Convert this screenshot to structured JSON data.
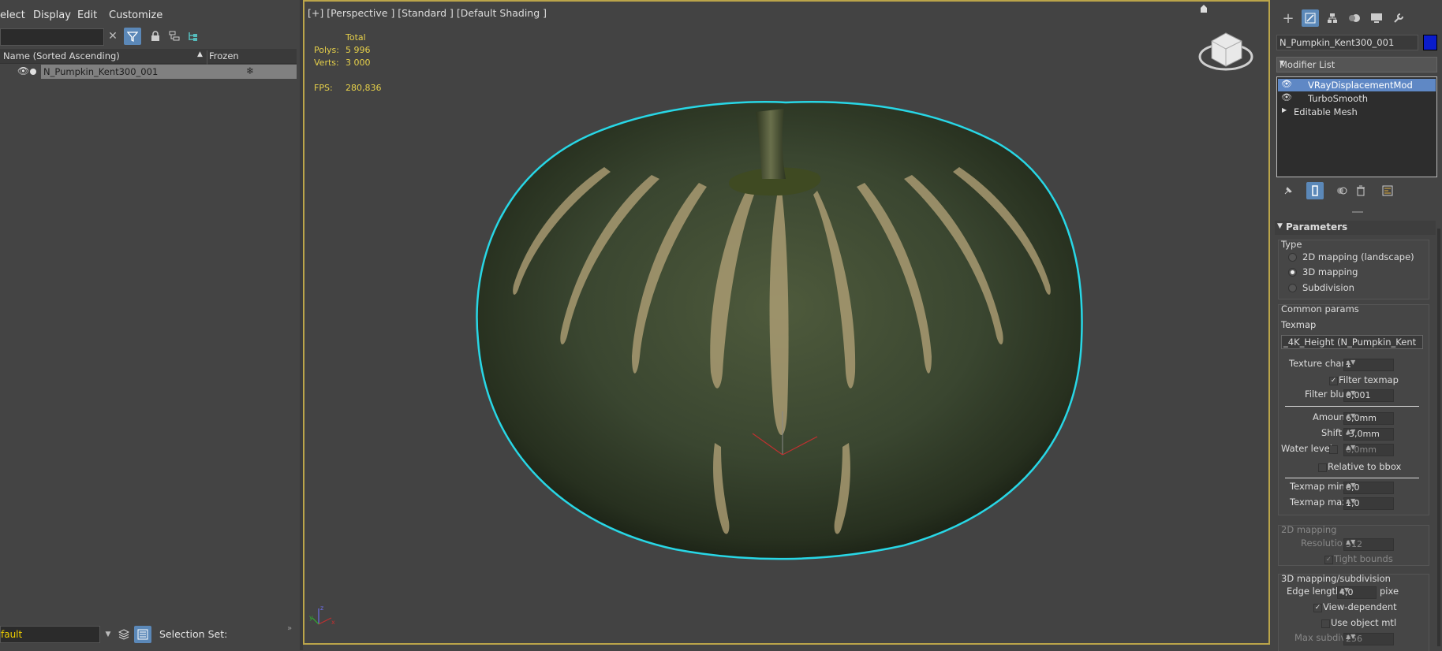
{
  "explorer": {
    "menu": [
      "elect",
      "Display",
      "Edit",
      "Customize"
    ],
    "columns": {
      "name": "Name (Sorted Ascending)",
      "sort_arrow": "▲",
      "frozen": "Frozen"
    },
    "rows": [
      {
        "label": "N_Pumpkin_Kent300_001"
      }
    ],
    "layer_value": "fault",
    "selection_set_label": "Selection Set:"
  },
  "viewport": {
    "label": "[+] [Perspective ] [Standard ] [Default Shading ]",
    "stats": {
      "total_label": "Total",
      "polys_label": "Polys:",
      "polys_value": "5 996",
      "verts_label": "Verts:",
      "verts_value": "3 000",
      "fps_label": "FPS:",
      "fps_value": "280,836"
    },
    "selection_outline_color": "#28d7e6",
    "border_color": "#bba54a"
  },
  "command_panel": {
    "object_name": "N_Pumpkin_Kent300_001",
    "object_color": "#0a1ccc",
    "modifier_list_label": "Modifier List",
    "stack": [
      {
        "label": "VRayDisplacementMod",
        "selected": true
      },
      {
        "label": "TurboSmooth",
        "selected": false
      },
      {
        "label": "Editable Mesh",
        "selected": false
      }
    ],
    "parameters": {
      "rollout_title": "Parameters",
      "type_group": "Type",
      "type_options": [
        {
          "label": "2D mapping (landscape)",
          "selected": false
        },
        {
          "label": "3D mapping",
          "selected": true
        },
        {
          "label": "Subdivision",
          "selected": false
        }
      ],
      "common_group": "Common params",
      "texmap_label": "Texmap",
      "texmap_value": "_4K_Height (N_Pumpkin_Kent",
      "texture_chan_label": "Texture chan",
      "texture_chan_value": "1",
      "filter_texmap_label": "Filter texmap",
      "filter_blur_label": "Filter blur",
      "filter_blur_value": "0,001",
      "amount_label": "Amount",
      "amount_value": "6,0mm",
      "shift_label": "Shift",
      "shift_value": "-3,0mm",
      "water_level_label": "Water level",
      "water_level_value": "0,0mm",
      "relative_bbox_label": "Relative to bbox",
      "texmap_min_label": "Texmap min",
      "texmap_min_value": "0,0",
      "texmap_max_label": "Texmap max",
      "texmap_max_value": "1,0",
      "mapping2d_group": "2D mapping",
      "resolution_label": "Resolution",
      "resolution_value": "512",
      "tight_bounds_label": "Tight bounds",
      "mapping3d_group": "3D mapping/subdivision",
      "edge_length_label": "Edge length",
      "edge_length_value": "4,0",
      "edge_length_unit": "pixe",
      "view_dependent_label": "View-dependent",
      "use_object_mtl_label": "Use object mtl",
      "max_subdivs_label": "Max subdivs",
      "max_subdivs_value": "256"
    }
  }
}
